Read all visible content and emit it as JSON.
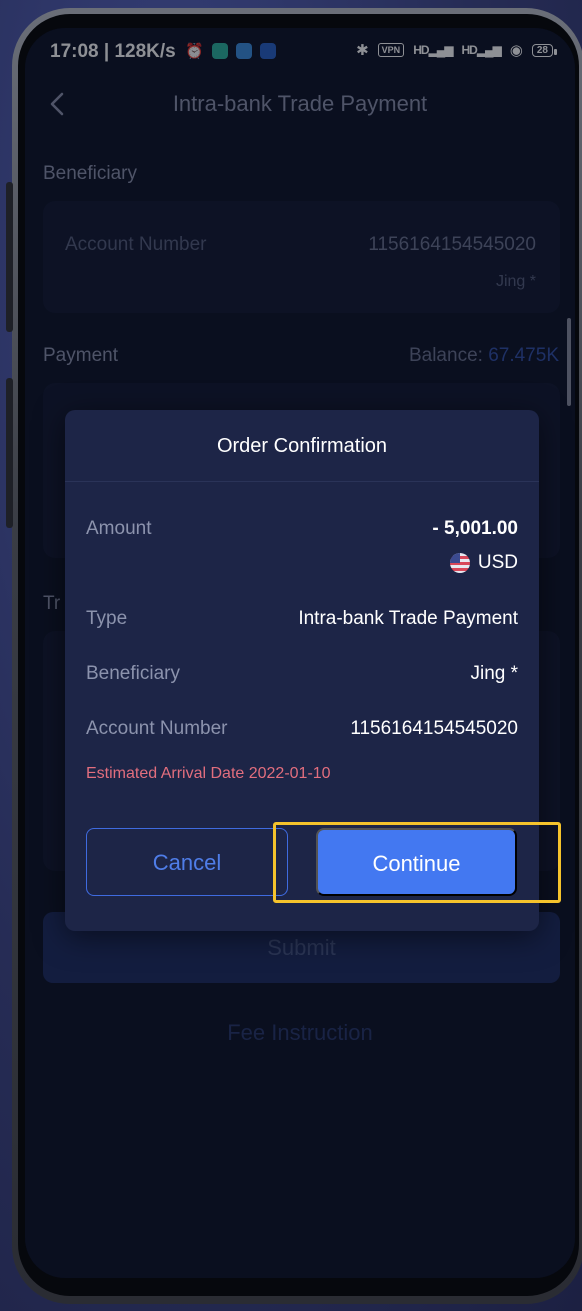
{
  "status_bar": {
    "time": "17:08 | 128K/s",
    "alarm": "⏰",
    "bluetooth": "✱",
    "vpn": "VPN",
    "signal1": "HD▂▄▆",
    "signal2": "HD▂▄▆",
    "wifi": "◉",
    "battery": "28"
  },
  "header": {
    "title": "Intra-bank Trade Payment"
  },
  "beneficiary": {
    "label": "Beneficiary",
    "account_label": "Account Number",
    "account_number": "1156164154545020",
    "name": "Jing *"
  },
  "payment": {
    "label": "Payment",
    "balance_label": "Balance:",
    "balance_value": "67.475K"
  },
  "background_partial_label": "Tr",
  "submit_label": "Submit",
  "fee_instruction": "Fee Instruction",
  "modal": {
    "title": "Order Confirmation",
    "amount_label": "Amount",
    "amount_value": "- 5,001.00",
    "currency": "USD",
    "type_label": "Type",
    "type_value": "Intra-bank Trade Payment",
    "beneficiary_label": "Beneficiary",
    "beneficiary_value": "Jing *",
    "account_label": "Account Number",
    "account_value": "1156164154545020",
    "arrival_text": "Estimated Arrival Date 2022-01-10",
    "cancel_label": "Cancel",
    "continue_label": "Continue"
  },
  "colors": {
    "accent": "#4378f1",
    "highlight": "#f5c32c",
    "warning_text": "#e26e7e",
    "balance": "#3f6be0"
  }
}
